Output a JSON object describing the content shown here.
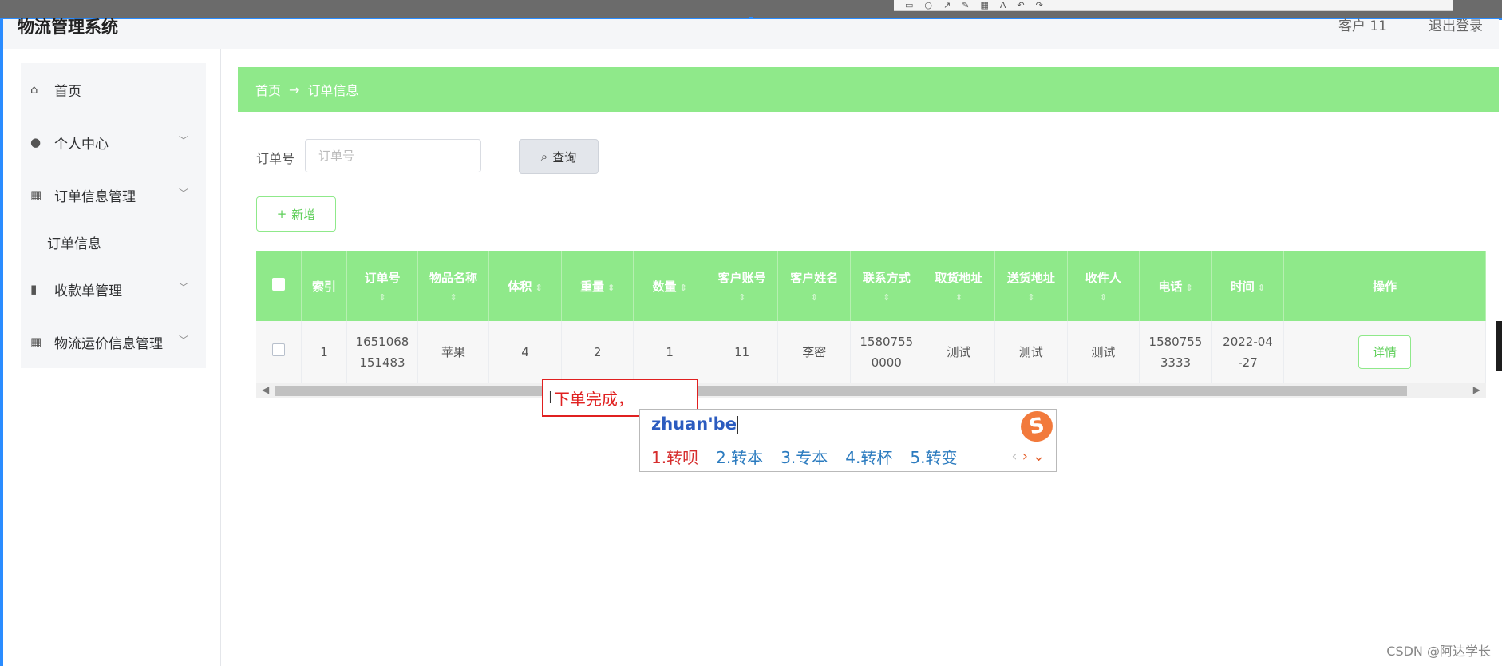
{
  "app": {
    "title": "物流管理系统",
    "user": "客户 11",
    "logout": "退出登录"
  },
  "sidebar": {
    "items": [
      {
        "icon": "home-icon",
        "glyph": "⌂",
        "label": "首页",
        "has_chevron": false
      },
      {
        "icon": "user-icon",
        "glyph": "👤",
        "label": "个人中心",
        "has_chevron": true
      },
      {
        "icon": "grid-icon",
        "glyph": "▦",
        "label": "订单信息管理",
        "has_chevron": true
      },
      {
        "icon": "chart-icon",
        "glyph": "▮",
        "label": "收款单管理",
        "has_chevron": true
      },
      {
        "icon": "grid-icon",
        "glyph": "▦",
        "label": "物流运价信息管理",
        "has_chevron": true
      }
    ],
    "sub_item": "订单信息"
  },
  "breadcrumb": {
    "home": "首页",
    "arrow": "→",
    "current": "订单信息"
  },
  "search": {
    "label": "订单号",
    "placeholder": "订单号",
    "button": "查询"
  },
  "actions": {
    "add": "新增"
  },
  "table": {
    "headers": [
      "索引",
      "订单号",
      "物品名称",
      "体积",
      "重量",
      "数量",
      "客户账号",
      "客户姓名",
      "联系方式",
      "取货地址",
      "送货地址",
      "收件人",
      "电话",
      "时间",
      "操作"
    ],
    "sort_glyph": "⇕",
    "rows": [
      {
        "index": "1",
        "order_no_1": "1651068",
        "order_no_2": "151483",
        "item": "苹果",
        "volume": "4",
        "weight": "2",
        "qty": "1",
        "account": "11",
        "name": "李密",
        "contact_1": "1580755",
        "contact_2": "0000",
        "pickup": "测试",
        "delivery": "测试",
        "recipient": "测试",
        "phone_1": "1580755",
        "phone_2": "3333",
        "time_1": "2022-04",
        "time_2": "-27",
        "action": "详情"
      }
    ]
  },
  "annotation": {
    "text": "下单完成，"
  },
  "ime": {
    "pinyin": "zhuan'be",
    "candidates": [
      "1.转呗",
      "2.转本",
      "3.专本",
      "4.转杯",
      "5.转变"
    ]
  },
  "watermark": "CSDN @阿达学长"
}
